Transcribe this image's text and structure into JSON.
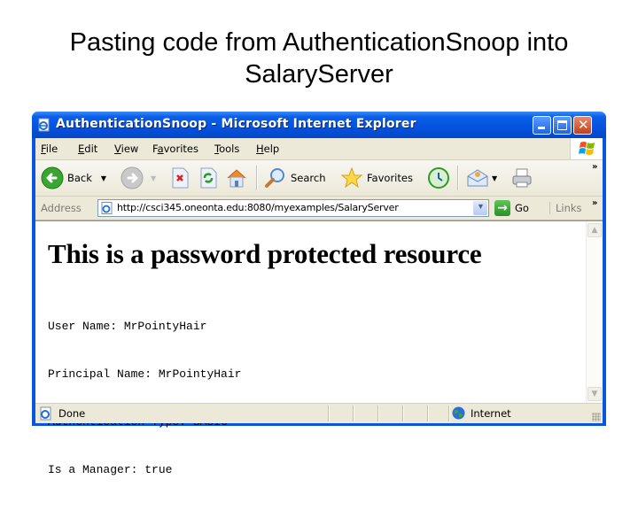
{
  "slide": {
    "title_line1": "Pasting code from AuthenticationSnoop into",
    "title_line2": "SalaryServer"
  },
  "window": {
    "title": "AuthenticationSnoop - Microsoft Internet Explorer",
    "controls": {
      "minimize": "minimize-icon",
      "maximize": "maximize-icon",
      "close": "close-icon"
    }
  },
  "menubar": {
    "items": [
      {
        "label": "File",
        "accel": "F"
      },
      {
        "label": "Edit",
        "accel": "E"
      },
      {
        "label": "View",
        "accel": "V"
      },
      {
        "label": "Favorites",
        "accel": "a"
      },
      {
        "label": "Tools",
        "accel": "T"
      },
      {
        "label": "Help",
        "accel": "H"
      }
    ]
  },
  "toolbar": {
    "back_label": "Back",
    "search_label": "Search",
    "favorites_label": "Favorites",
    "more": "»"
  },
  "addressbar": {
    "label": "Address",
    "url": "http://csci345.oneonta.edu:8080/myexamples/SalaryServer",
    "go_label": "Go",
    "links_label": "Links",
    "more": "»"
  },
  "page": {
    "heading": "This is a password protected resource",
    "fields": [
      {
        "label": "User Name:",
        "value": "MrPointyHair"
      },
      {
        "label": "Principal Name:",
        "value": "MrPointyHair"
      },
      {
        "label": "Authentication Type:",
        "value": "BASIC"
      },
      {
        "label": "Is a Manager:",
        "value": "true"
      }
    ]
  },
  "statusbar": {
    "status": "Done",
    "zone": "Internet"
  },
  "colors": {
    "titlebar_blue": "#0553de",
    "chrome_beige": "#ece9d8",
    "close_red": "#c1411c"
  }
}
